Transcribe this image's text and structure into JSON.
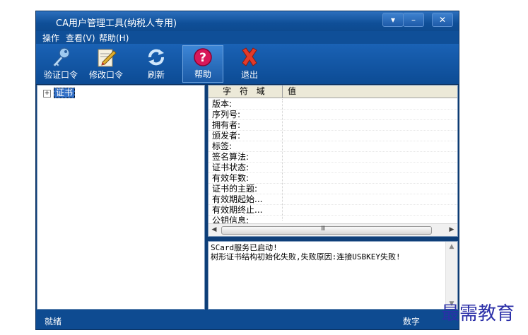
{
  "window": {
    "title": "CA用户管理工具(纳税人专用)",
    "controls": [
      "▾",
      "–",
      "✕"
    ]
  },
  "menu": [
    "操作",
    "查看(V)",
    "帮助(H)"
  ],
  "toolbar": [
    {
      "label": "验证口令",
      "icon": "key-icon",
      "active": false
    },
    {
      "label": "修改口令",
      "icon": "edit-icon",
      "active": false
    },
    {
      "label": "刷新",
      "icon": "refresh-icon",
      "active": false
    },
    {
      "label": "帮助",
      "icon": "help-icon",
      "active": true
    },
    {
      "label": "退出",
      "icon": "exit-icon",
      "active": false
    }
  ],
  "tree": {
    "expander": "+",
    "root_label": "证书"
  },
  "properties": {
    "columns": [
      "字 符 域",
      "值"
    ],
    "rows": [
      "版本:",
      "序列号:",
      "拥有者:",
      "颁发者:",
      "标签:",
      "签名算法:",
      "证书状态:",
      "有效年数:",
      "证书的主题:",
      "有效期起始...",
      "有效期终止...",
      "公钥信息:"
    ]
  },
  "log": {
    "lines": [
      "SCard服务已启动!",
      "树形证书结构初始化失败,失败原因:连接USBKEY失败!"
    ]
  },
  "status": {
    "left": "就绪",
    "right": "数字"
  },
  "watermark": "最需教育",
  "colors": {
    "window_blue": "#0d3e78",
    "selection": "#3470c6",
    "watermark": "#2b2fa8"
  }
}
